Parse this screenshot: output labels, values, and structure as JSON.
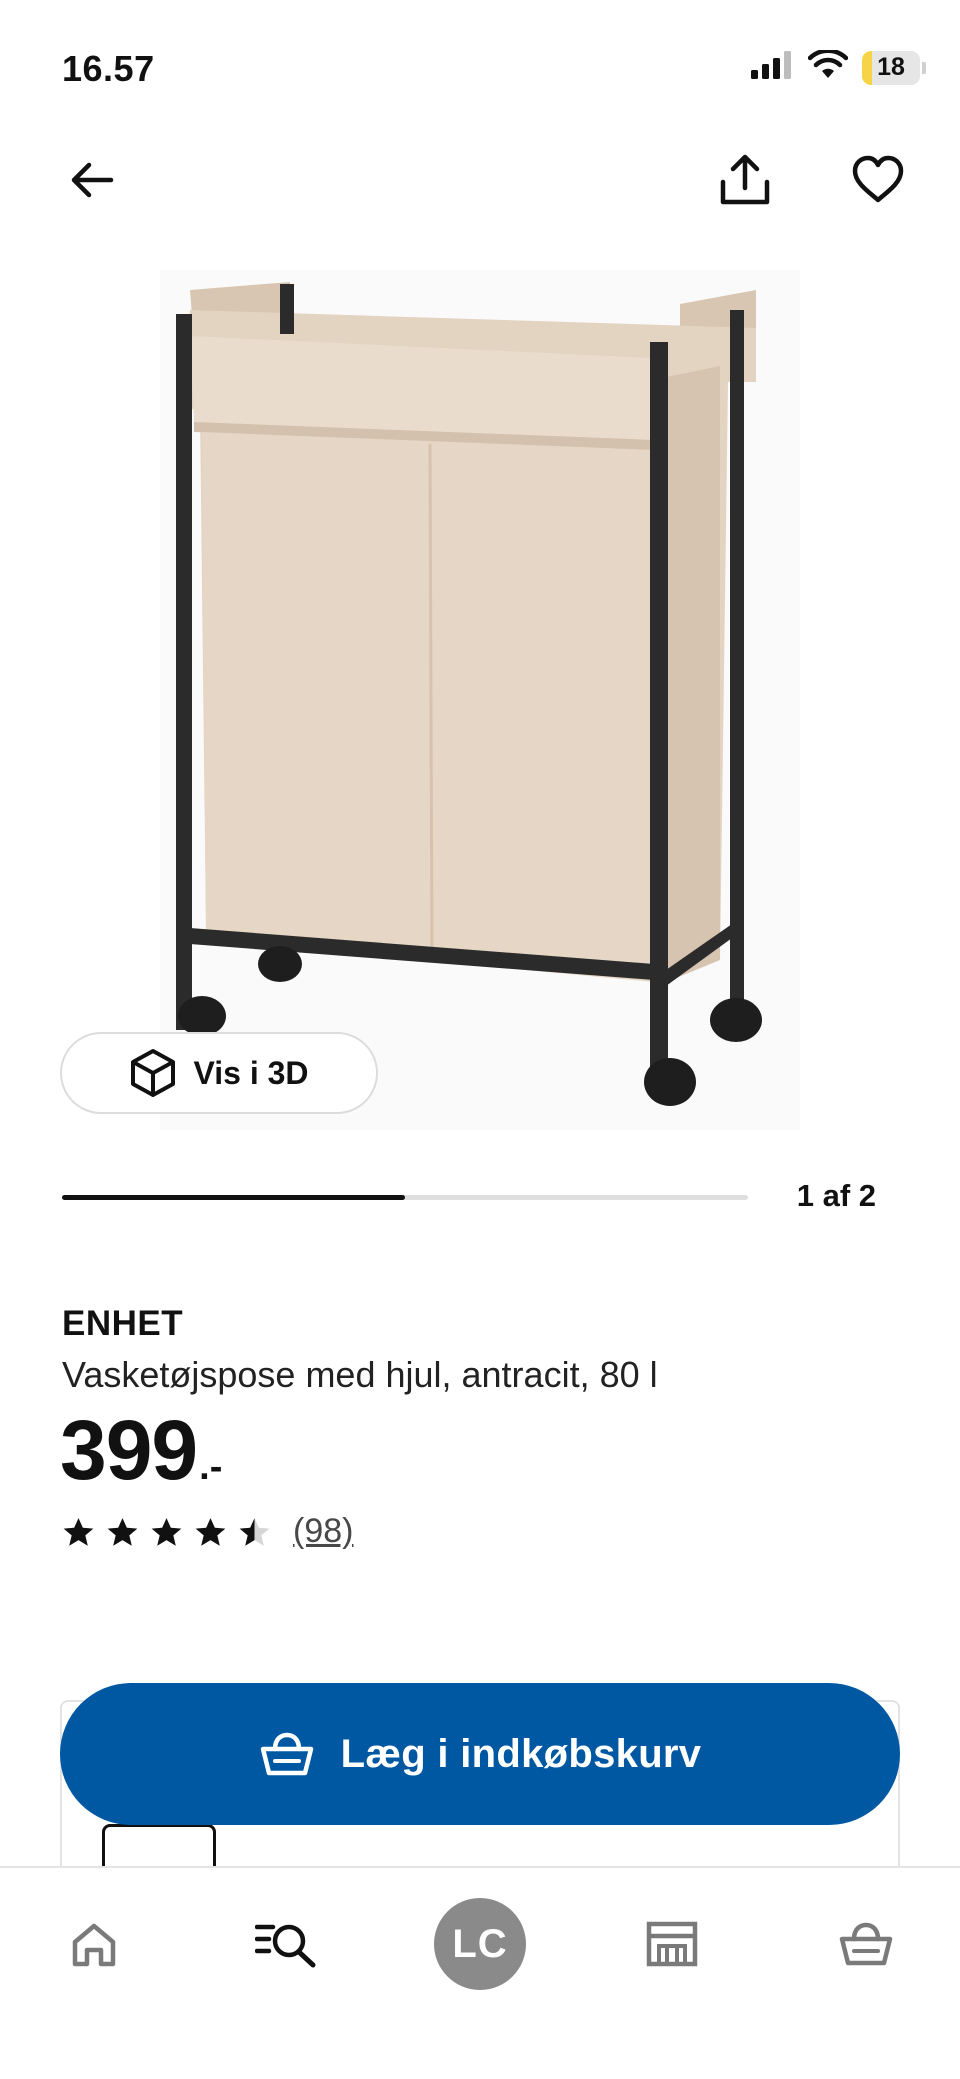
{
  "status_bar": {
    "time": "16.57",
    "battery_level": "18",
    "battery_fill_percent": 18,
    "icons": [
      "cellular-signal-icon",
      "wifi-icon",
      "battery-icon"
    ]
  },
  "header": {
    "icons": [
      "back-arrow-icon",
      "share-icon",
      "heart-icon"
    ]
  },
  "media": {
    "view_3d_label": "Vis i 3D",
    "view_3d_icon": "cube-icon",
    "carousel_counter": "1 af 2",
    "carousel_current": 1,
    "carousel_total": 2
  },
  "product": {
    "name": "ENHET",
    "description": "Vasketøjspose med hjul, antracit, 80 l",
    "price": "399",
    "price_suffix": ".-",
    "rating_value": 4.5,
    "rating_max": 5,
    "review_count": "(98)"
  },
  "purchase": {
    "add_to_cart_label": "Læg i indkøbskurv",
    "add_to_cart_icon": "basket-icon"
  },
  "bottom_nav": {
    "items": [
      {
        "icon": "home-icon"
      },
      {
        "icon": "search-list-icon"
      },
      {
        "avatar_initials": "LC"
      },
      {
        "icon": "store-icon"
      },
      {
        "icon": "basket-icon"
      }
    ]
  },
  "colors": {
    "brand_blue": "#0058a3",
    "text": "#111111",
    "avatar_grey": "#8a8a8a",
    "fabric_beige": "#e3d3c1",
    "frame_dark": "#2b2b2b",
    "battery_yellow": "#f5d547"
  }
}
